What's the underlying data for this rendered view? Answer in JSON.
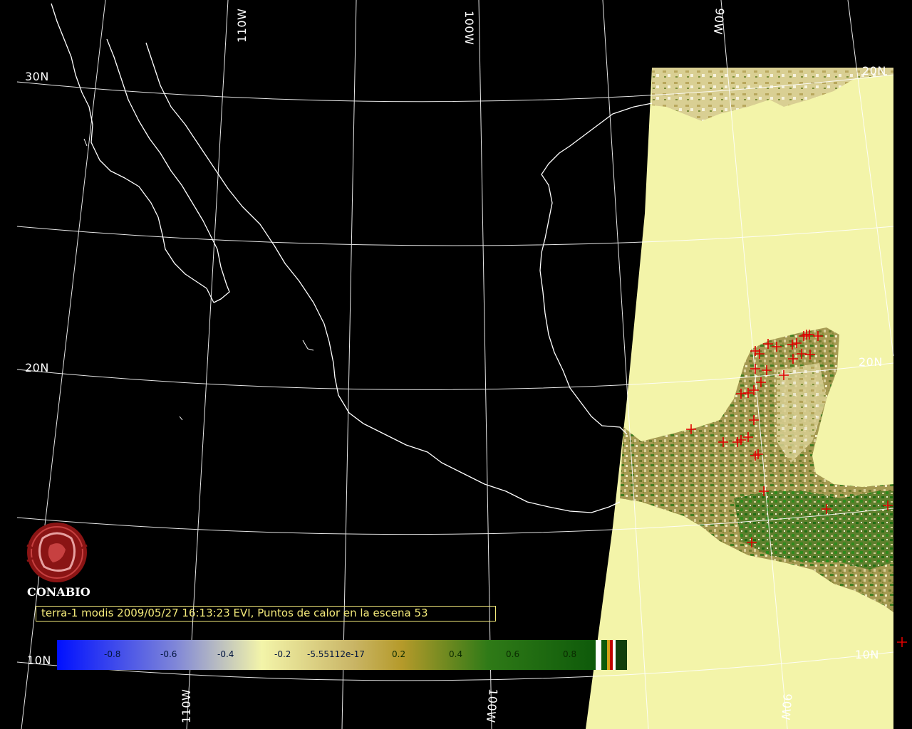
{
  "latitude_labels": [
    "30N",
    "20N",
    "20N",
    "20N",
    "10N",
    "10N"
  ],
  "longitude_labels_top": [
    "110W",
    "100W",
    "90W"
  ],
  "longitude_labels_bottom": [
    "110W",
    "100W",
    "90W"
  ],
  "logo": {
    "name": "CONABIO",
    "icon": "conabio-logo-icon"
  },
  "caption": "terra-1 modis 2009/05/27 16:13:23 EVI, Puntos de calor en la escena 53",
  "colorbar": {
    "ticks": [
      "-0.8",
      "-0.6",
      "-0.4",
      "-0.2",
      "-5.55112e-17",
      "0.2",
      "0.4",
      "0.6",
      "0.8"
    ],
    "end_colors": [
      "#ffffff",
      "#d4a017",
      "#c00000",
      "#ffffff",
      "#1f5c16"
    ]
  },
  "colors": {
    "background": "#000000",
    "coastline": "#ffffff",
    "gridline": "#ffffff",
    "no_data_fill": "#f3f4a9",
    "vegetation_low": "#c8b070",
    "vegetation_high": "#2c7a1c",
    "hotspot": "#e00000",
    "caption": "#f3e97a"
  },
  "hotspot_count": 53,
  "hotspot_marker_icon": "cross-icon"
}
